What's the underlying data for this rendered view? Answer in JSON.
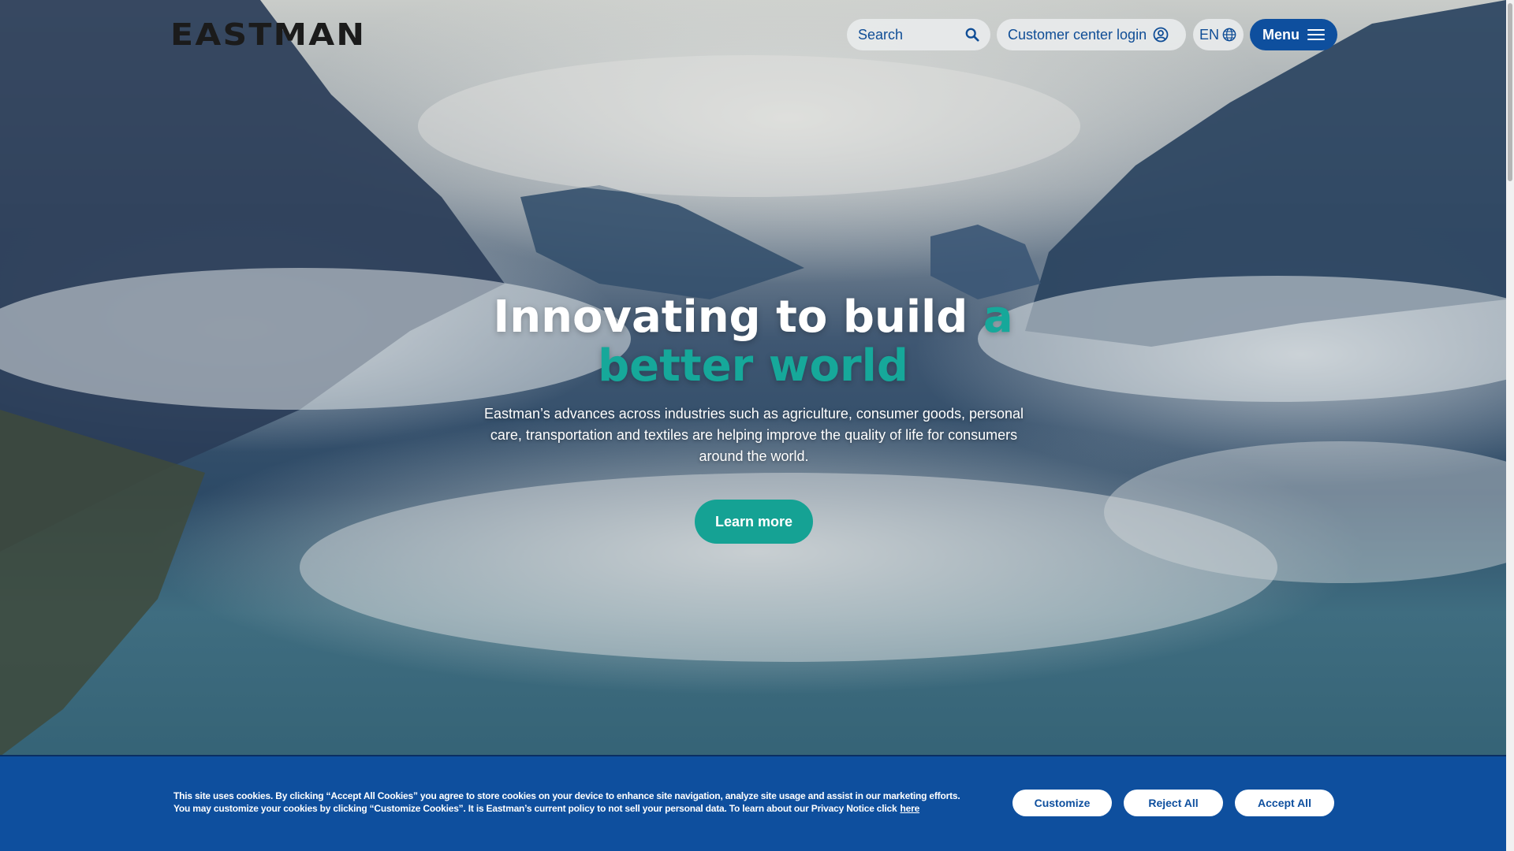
{
  "brand": {
    "logo_text": "EASTMAN"
  },
  "header": {
    "search_placeholder": "Search",
    "login_label": "Customer center login",
    "language_label": "EN",
    "menu_label": "Menu"
  },
  "hero": {
    "headline_part1": "Innovating to build ",
    "headline_accent": "a better world",
    "lede": "Eastman’s advances across industries such as agriculture, consumer goods, personal care, transportation and textiles are helping improve the quality of life for consumers around the world.",
    "cta_label": "Learn more"
  },
  "cookie_banner": {
    "text": "This site uses cookies. By clicking “Accept All Cookies” you agree to store cookies on your device to enhance site navigation, analyze site usage and assist in our marketing efforts. You may customize your cookies by clicking “Customize Cookies”. It is Eastman’s current policy to not sell your personal data. To learn about our Privacy Notice click",
    "link_label": "here",
    "customize_label": "Customize",
    "reject_label": "Reject All",
    "accept_label": "Accept All"
  },
  "colors": {
    "brand_blue": "#0e4f9e",
    "accent_teal": "#16a89a"
  },
  "icons": [
    "search-icon",
    "user-circle-icon",
    "globe-icon",
    "hamburger-icon"
  ]
}
